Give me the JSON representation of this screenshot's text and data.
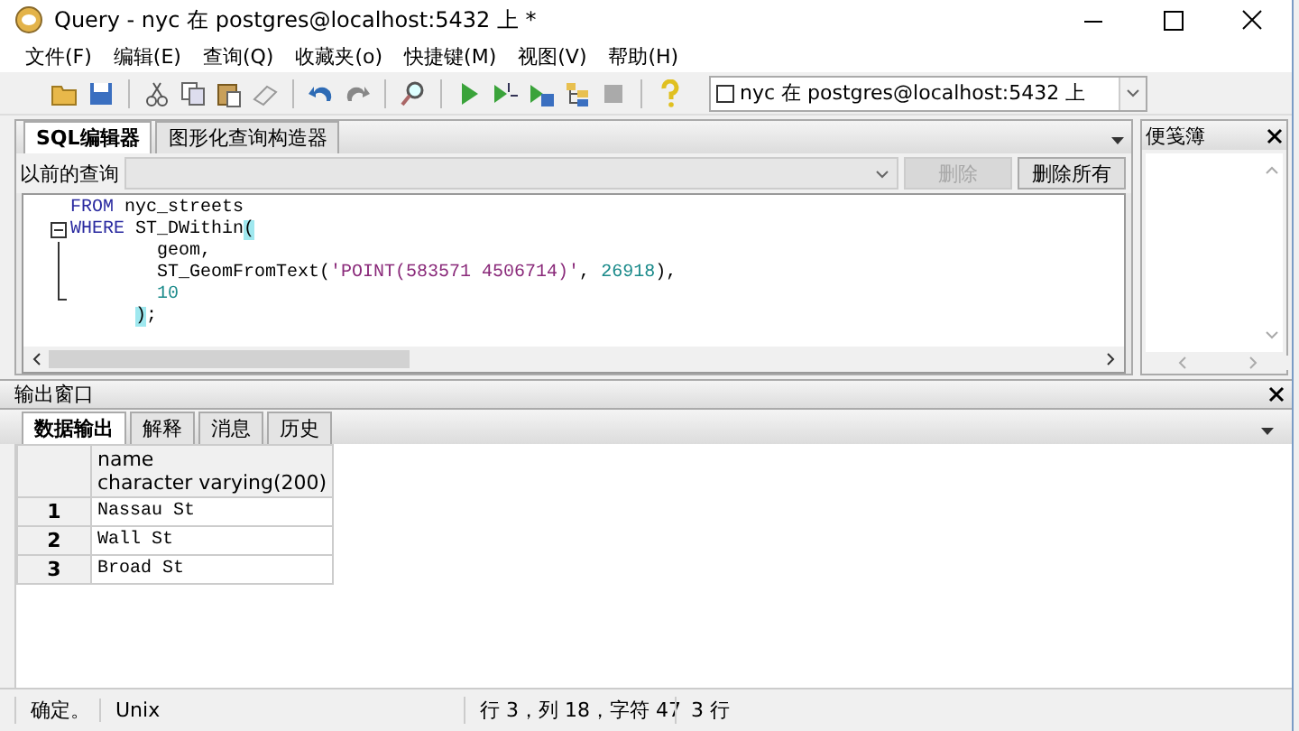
{
  "window": {
    "title": "Query - nyc 在  postgres@localhost:5432 上 *"
  },
  "menu": [
    "文件(F)",
    "编辑(E)",
    "查询(Q)",
    "收藏夹(o)",
    "快捷键(M)",
    "视图(V)",
    "帮助(H)"
  ],
  "connection": {
    "value": "nyc 在  postgres@localhost:5432 上"
  },
  "editor_tabs": [
    {
      "label": "SQL编辑器",
      "selected": true
    },
    {
      "label": "图形化查询构造器",
      "selected": false
    }
  ],
  "history": {
    "label": "以前的查询",
    "buttons": [
      {
        "label": "删除",
        "disabled": true
      },
      {
        "label": "删除所有",
        "disabled": false
      }
    ]
  },
  "code_lines": [
    {
      "kind": "top",
      "tokens": [
        {
          "kind": "keyword",
          "text": "FROM"
        },
        {
          "kind": "plain",
          "text": " nyc_streets"
        }
      ]
    },
    {
      "kind": "fold_start",
      "tokens": [
        {
          "kind": "keyword",
          "text": "WHERE"
        },
        {
          "kind": "plain",
          "text": " ST_DWithin"
        },
        {
          "kind": "bracket",
          "text": "("
        }
      ]
    },
    {
      "kind": "fold_body",
      "tokens": [
        {
          "kind": "plain",
          "text": "geom,"
        }
      ]
    },
    {
      "kind": "fold_body",
      "tokens": [
        {
          "kind": "plain",
          "text": "ST_GeomFromText("
        },
        {
          "kind": "string",
          "text": "'POINT(583571 4506714)'"
        },
        {
          "kind": "plain",
          "text": ", "
        },
        {
          "kind": "number",
          "text": "26918"
        },
        {
          "kind": "plain",
          "text": "),"
        }
      ]
    },
    {
      "kind": "fold_end",
      "tokens": [
        {
          "kind": "number",
          "text": "10"
        }
      ]
    },
    {
      "kind": "close",
      "tokens": [
        {
          "kind": "bracket",
          "text": ")"
        },
        {
          "kind": "plain",
          "text": ";"
        }
      ]
    }
  ],
  "scratch_pad": {
    "title": "便笺簿"
  },
  "output": {
    "title": "输出窗口",
    "tabs": [
      {
        "label": "数据输出",
        "selected": true
      },
      {
        "label": "解释",
        "selected": false
      },
      {
        "label": "消息",
        "selected": false
      },
      {
        "label": "历史",
        "selected": false
      }
    ],
    "table": {
      "columns": [
        {
          "name": "name",
          "type": "character varying(200)"
        }
      ],
      "rows": [
        {
          "number": "1",
          "cells": [
            "Nassau St"
          ]
        },
        {
          "number": "2",
          "cells": [
            "Wall St"
          ]
        },
        {
          "number": "3",
          "cells": [
            "Broad St"
          ]
        }
      ]
    }
  },
  "status_bar": [
    "确定。",
    "Unix",
    "行 3，列 18，字符 47",
    "3 行"
  ]
}
